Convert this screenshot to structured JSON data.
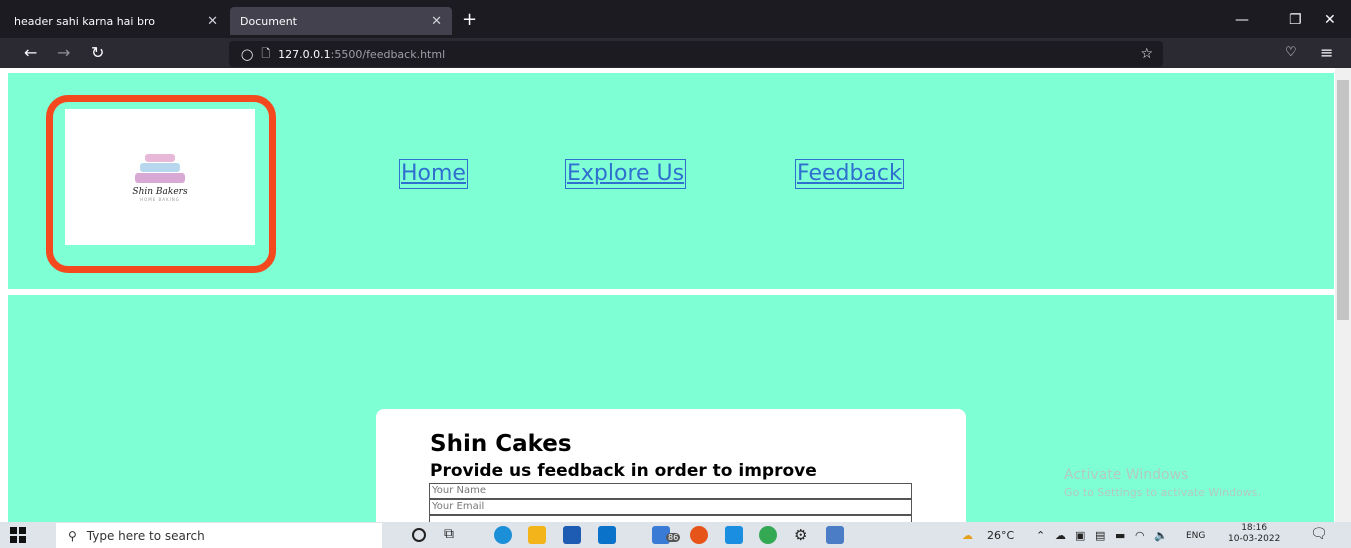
{
  "browser": {
    "tabs": [
      {
        "title": "header sahi karna hai bro",
        "close": "✕"
      },
      {
        "title": "Document",
        "close": "✕"
      }
    ],
    "new_tab": "+",
    "url_host": "127.0.0.1",
    "url_path": ":5500/feedback.html"
  },
  "page": {
    "logo_text": "Shin Bakers",
    "logo_sub": "HOME BAKING",
    "nav": [
      "Home",
      "Explore Us",
      "Feedback"
    ],
    "card_title": "Shin Cakes",
    "card_subtitle": "Provide us feedback in order to improve",
    "fields": [
      "Your Name",
      "Your Email"
    ],
    "highlight_color": "#f4481f",
    "bg_color": "#7fffd4"
  },
  "watermark": {
    "title": "Activate Windows",
    "subtitle": "Go to Settings to activate Windows."
  },
  "taskbar": {
    "search_placeholder": "Type here to search",
    "badge": "86",
    "weather": "26°C",
    "lang": "ENG",
    "time": "18:16",
    "date": "10-03-2022"
  }
}
